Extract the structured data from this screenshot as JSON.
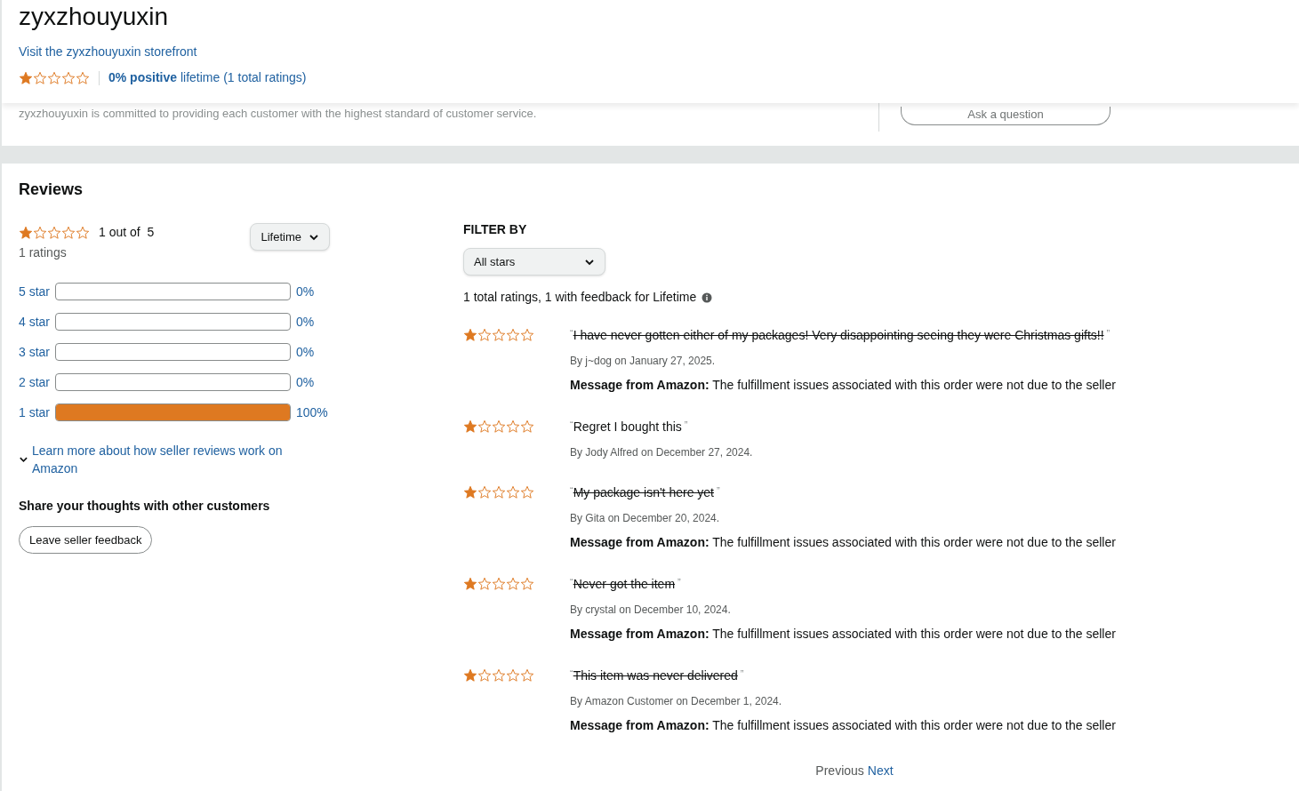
{
  "seller": {
    "name": "zyxzhouyuxin",
    "storefront_link": "Visit the zyxzhouyuxin storefront",
    "stars": 1,
    "rating_summary": "**0% positive** lifetime (1 total ratings)",
    "description": "zyxzhouyuxin is committed to providing each customer with the highest standard of customer service.",
    "ask_button": "Ask a question"
  },
  "reviews": {
    "title": "Reviews",
    "summary": {
      "stars": 1,
      "score": "1 out of  5",
      "count": "1 ratings",
      "period": "Lifetime"
    },
    "histogram": [
      {
        "label": "5 star",
        "level": 0,
        "percent": "0%"
      },
      {
        "label": "4 star",
        "level": 0,
        "percent": "0%"
      },
      {
        "label": "3 star",
        "level": 0,
        "percent": "0%"
      },
      {
        "label": "2 star",
        "level": 0,
        "percent": "0%"
      },
      {
        "label": "1 star",
        "level": 1,
        "percent": "100%"
      }
    ],
    "learn_more": "Learn more about how seller reviews work on Amazon",
    "expanded": false,
    "share_heading": "Share your thoughts with other customers",
    "feedback_button": "Leave seller feedback",
    "filter": {
      "heading": "FILTER BY",
      "value": "All stars",
      "count_text": "1 total ratings, 1 with feedback for Lifetime"
    },
    "items": [
      {
        "stars": 1,
        "open_quote": "“",
        "text": "I have never gotten either of my packages! Very disappointing seeing they were Christmas gifts!!",
        "close_quote": "”",
        "struck": true,
        "byline": "By j~dog on January 27, 2025.",
        "message": "**Message from Amazon:** The fulfillment issues associated with this order were not due to the seller"
      },
      {
        "stars": 1,
        "open_quote": "“",
        "text": "Regret I bought this",
        "close_quote": "”",
        "struck": false,
        "byline": "By Jody Alfred on December 27, 2024."
      },
      {
        "stars": 1,
        "open_quote": "“",
        "text": "My package isn't here yet",
        "close_quote": "”",
        "struck": true,
        "byline": "By Gita on December 20, 2024.",
        "message": "**Message from Amazon:** The fulfillment issues associated with this order were not due to the seller"
      },
      {
        "stars": 1,
        "open_quote": "“",
        "text": "Never got the item",
        "close_quote": "”",
        "struck": true,
        "byline": "By crystal on December 10, 2024.",
        "message": "**Message from Amazon:** The fulfillment issues associated with this order were not due to the seller"
      },
      {
        "stars": 1,
        "open_quote": "“",
        "text": "This item was never delivered",
        "close_quote": "”",
        "struck": true,
        "byline": "By Amazon Customer on December 1, 2024.",
        "message": "**Message from Amazon:** The fulfillment issues associated with this order were not due to the seller"
      }
    ],
    "pagination": {
      "previous": "Previous",
      "next": "Next"
    }
  }
}
